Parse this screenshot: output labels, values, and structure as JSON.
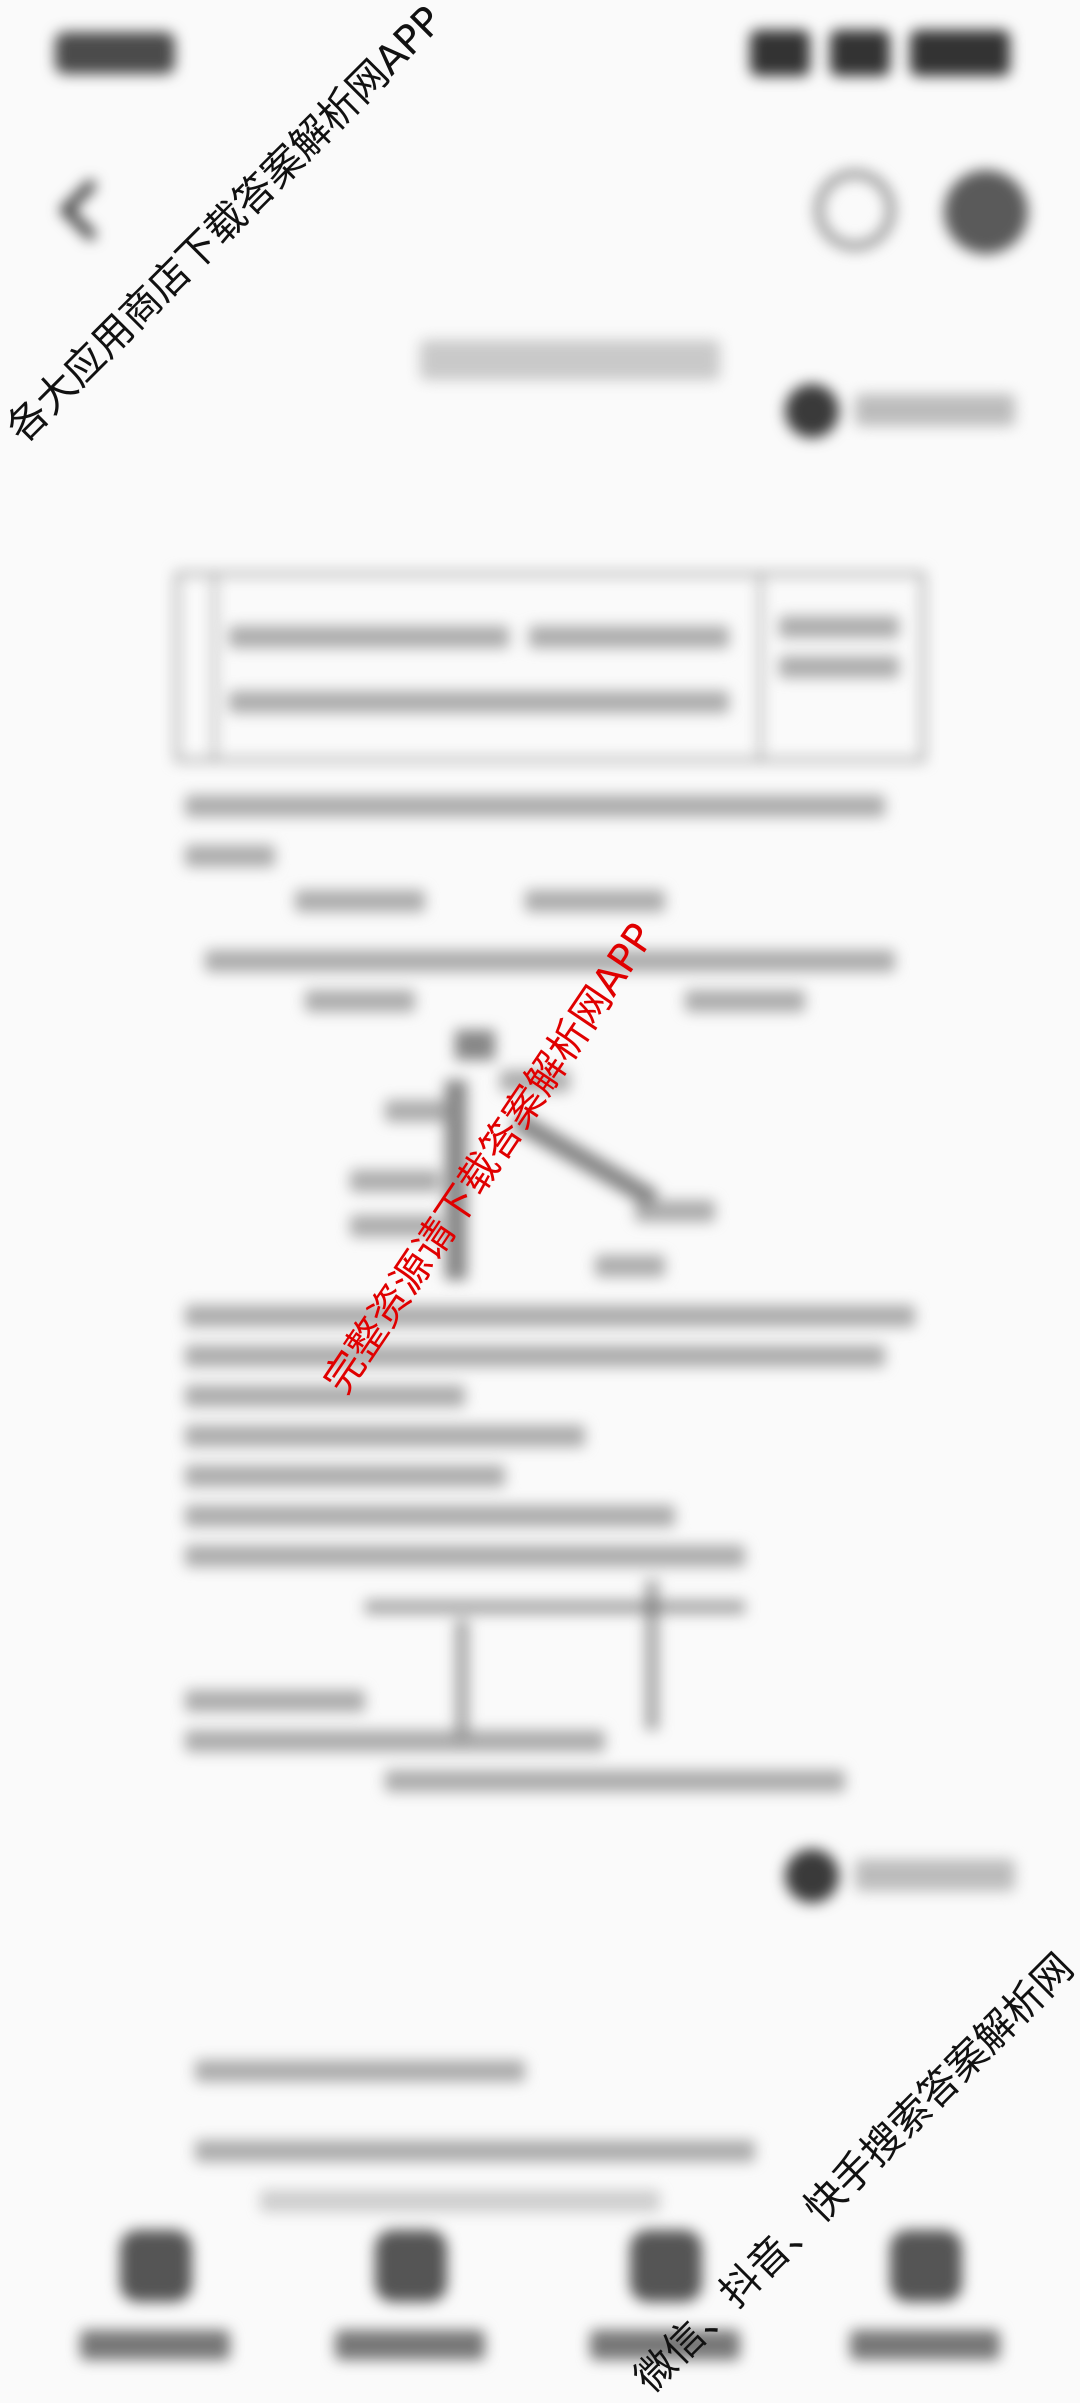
{
  "status_bar": {
    "time": "",
    "icons": [
      "signal-icon",
      "wifi-icon",
      "battery-icon"
    ]
  },
  "top_nav": {
    "back_icon": "arrow-left-icon",
    "history_icon": "clock-icon",
    "menu_icon": "grid-icon"
  },
  "document": {
    "page_title": "",
    "page_chip_label": "",
    "second_chip_label": ""
  },
  "bottom_tabs": [
    {
      "icon": "home-icon",
      "label": ""
    },
    {
      "icon": "book-icon",
      "label": ""
    },
    {
      "icon": "answer-icon",
      "label": ""
    },
    {
      "icon": "profile-icon",
      "label": ""
    }
  ],
  "watermarks": {
    "top": "各大应用商店下载答案解析网APP",
    "middle": "完整资源请下载答案解析网APP",
    "bottom": "微信、抖音、快手搜索答案解析网"
  },
  "colors": {
    "middle_watermark": "#e00000",
    "background": "#fafafa"
  }
}
